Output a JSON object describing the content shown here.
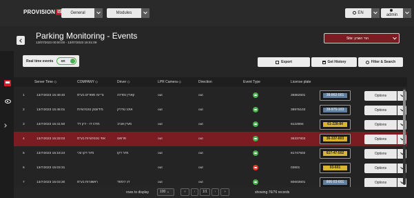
{
  "header": {
    "logo_text": "PROVISION",
    "logo_box": "ISR",
    "general": "General",
    "modules": "Modules",
    "language": "EN",
    "user": "admin"
  },
  "title": {
    "main": "Parking Monitoring - Events",
    "range": "13/07/2023 00:00:00 - 13/07/2023 16:01:09",
    "site": "Site: הוד השרון"
  },
  "toolbar": {
    "realtime_label": "Real time events",
    "toggle_label": "on",
    "export": "Export",
    "history": "Get History",
    "filter": "Filter & Search"
  },
  "table": {
    "columns": [
      "Server Time",
      "COMPANY",
      "Driver",
      "LPR Camera",
      "Direction",
      "Event Type",
      "License plate"
    ],
    "rows": [
      {
        "n": "1",
        "time": "13/7/2023 15:49:40",
        "company": "צ'יינה סופרים בע\"מ",
        "driver": "קארין נסרלה",
        "camera": "out",
        "direction": "out",
        "event": "green",
        "plate": "35862501",
        "plate_img": "38-862-501",
        "options": "Options"
      },
      {
        "n": "2",
        "time": "13/7/2023 15:45:01",
        "company": "מידעטק טכנולוגיות",
        "driver": "אולג טרליק",
        "camera": "out",
        "direction": "out",
        "event": "green",
        "plate": "39975103",
        "plate_img": "39-975-103",
        "options": "Options"
      },
      {
        "n": "3",
        "time": "13/7/2023 15:41:50",
        "company": "מרכז דו - ליק דד",
        "driver": "מעיין אביב",
        "camera": "out",
        "direction": "out",
        "event": "green",
        "plate": "6122884",
        "plate_img": "61-228-84",
        "options": "Options"
      },
      {
        "n": "4",
        "time": "13/7/2023 15:33:03",
        "company": "אפי טכנולוגיות בע\"מ",
        "driver": "פרואט",
        "camera": "out",
        "direction": "out",
        "event": "green",
        "plate": "36337803",
        "plate_img": "36-337-803",
        "options": "Options"
      },
      {
        "n": "5",
        "time": "13/7/2023 15:18:24",
        "company": "מיור דקו עלי",
        "driver": "מיור דקו",
        "camera": "out",
        "direction": "out",
        "event": "green",
        "plate": "61747502",
        "plate_img": "617-47-502",
        "options": "Options"
      },
      {
        "n": "6",
        "time": "13/7/2023 15:03:31",
        "company": "",
        "driver": "",
        "camera": "out",
        "direction": "out",
        "event": "red",
        "plate": "03601",
        "plate_img": "03-601",
        "options": "Options"
      },
      {
        "n": "7",
        "time": "13/7/2023 15:03:30",
        "company": "ראשוניות בע\"מ",
        "driver": "דנ לימוזד",
        "camera": "out",
        "direction": "out",
        "event": "green",
        "plate": "80603601",
        "plate_img": "806-03-601",
        "options": "Options"
      }
    ]
  },
  "footer": {
    "rows_label": "rows to display",
    "rows_value": "100",
    "page": "1/1",
    "showing": "showing 76/76 records"
  },
  "colors": {
    "accent_red": "#c8102e",
    "selected_row": "#7b1c22",
    "event_green": "#4caf50",
    "event_red": "#e53935"
  }
}
